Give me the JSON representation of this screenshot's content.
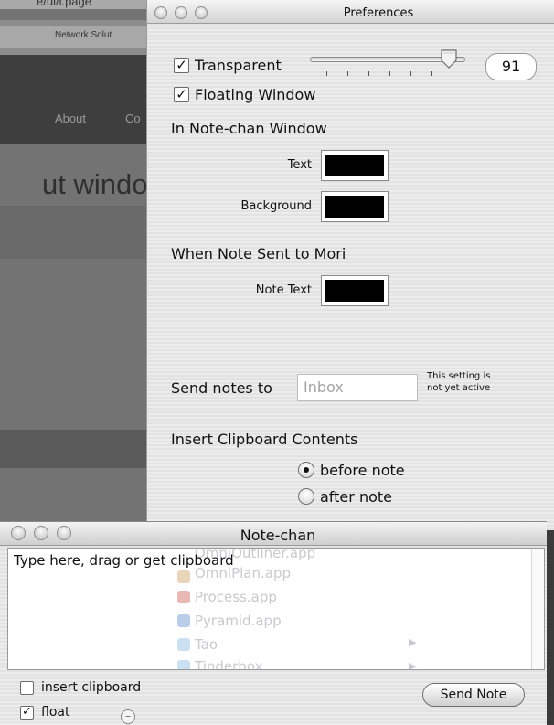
{
  "background_browser": {
    "tab_fragment": "e/ui/i.page",
    "address_fragment": "Network Solut",
    "nav_about": "About",
    "nav_next_fragment": "Co",
    "heading_fragment": "ut windo"
  },
  "preferences": {
    "window_title": "Preferences",
    "transparent_label": "Transparent",
    "transparent_checked": true,
    "transparency_value": "91",
    "floating_label": "Floating Window",
    "floating_checked": true,
    "in_window_heading": "In Note-chan Window",
    "text_color_label": "Text",
    "text_color": "#000000",
    "background_color_label": "Background",
    "background_color": "#000000",
    "sent_heading": "When Note Sent to Mori",
    "note_text_label": "Note Text",
    "note_text_color": "#000000",
    "send_notes_label": "Send notes to",
    "send_notes_placeholder": "Inbox",
    "setting_note_line1": "This setting is",
    "setting_note_line2": "not yet active",
    "clipboard_heading": "Insert Clipboard Contents",
    "radio_before": "before note",
    "radio_after": "after note",
    "radio_selected": "before note"
  },
  "notechan": {
    "window_title": "Note-chan",
    "note_text": "Type here, drag or get clipboard",
    "ghost_items": [
      "OmniOutliner.app",
      "OmniPlan.app",
      "Process.app",
      "Pyramid.app",
      "Tao",
      "Tinderbox"
    ],
    "insert_clipboard_label": "insert clipboard",
    "insert_clipboard_checked": false,
    "float_label": "float",
    "float_checked": true,
    "send_button": "Send Note"
  }
}
